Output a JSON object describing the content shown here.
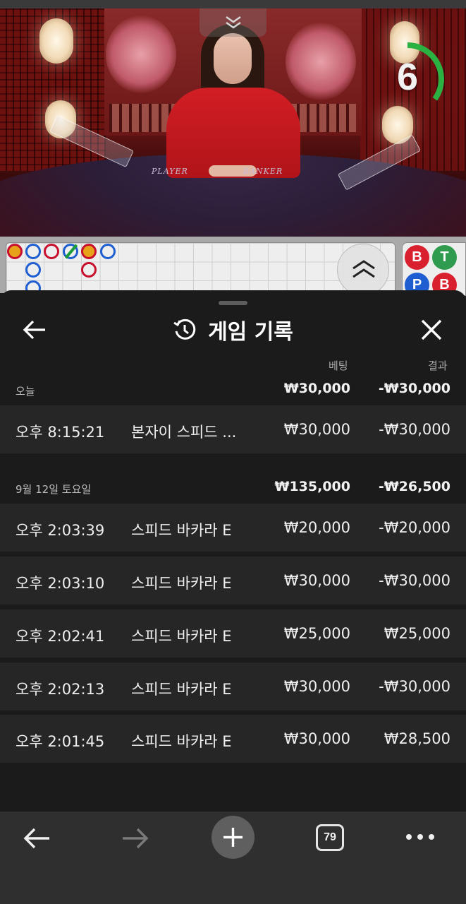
{
  "video": {
    "table_label_player": "PLAYER",
    "table_label_banker": "BANKER",
    "countdown": "6",
    "countdown_progress": 0.35
  },
  "roadmap": {
    "side_buttons": [
      {
        "label": "B",
        "color": "#d8202e"
      },
      {
        "label": "T",
        "color": "#2e9b4e"
      },
      {
        "label": "P",
        "color": "#1f5ed1"
      },
      {
        "label": "B",
        "color": "#d8202e"
      }
    ]
  },
  "history": {
    "title": "게임 기록",
    "columns": {
      "bet": "베팅",
      "result": "결과"
    },
    "groups": [
      {
        "label": "오늘",
        "total_bet": "₩30,000",
        "total_result": "-₩30,000",
        "rows": [
          {
            "time": "오후 8:15:21",
            "game": "본자이 스피드 ...",
            "bet": "₩30,000",
            "result": "-₩30,000"
          }
        ]
      },
      {
        "label": "9월 12일 토요일",
        "total_bet": "₩135,000",
        "total_result": "-₩26,500",
        "rows": [
          {
            "time": "오후 2:03:39",
            "game": "스피드 바카라 E",
            "bet": "₩20,000",
            "result": "-₩20,000"
          },
          {
            "time": "오후 2:03:10",
            "game": "스피드 바카라 E",
            "bet": "₩30,000",
            "result": "-₩30,000"
          },
          {
            "time": "오후 2:02:41",
            "game": "스피드 바카라 E",
            "bet": "₩25,000",
            "result": "₩25,000"
          },
          {
            "time": "오후 2:02:13",
            "game": "스피드 바카라 E",
            "bet": "₩30,000",
            "result": "-₩30,000"
          },
          {
            "time": "오후 2:01:45",
            "game": "스피드 바카라 E",
            "bet": "₩30,000",
            "result": "₩28,500"
          }
        ]
      }
    ]
  },
  "navbar": {
    "tab_count": "79",
    "icons": [
      "back-arrow-icon",
      "forward-arrow-icon",
      "plus-icon",
      "tabs-icon",
      "more-icon"
    ]
  }
}
